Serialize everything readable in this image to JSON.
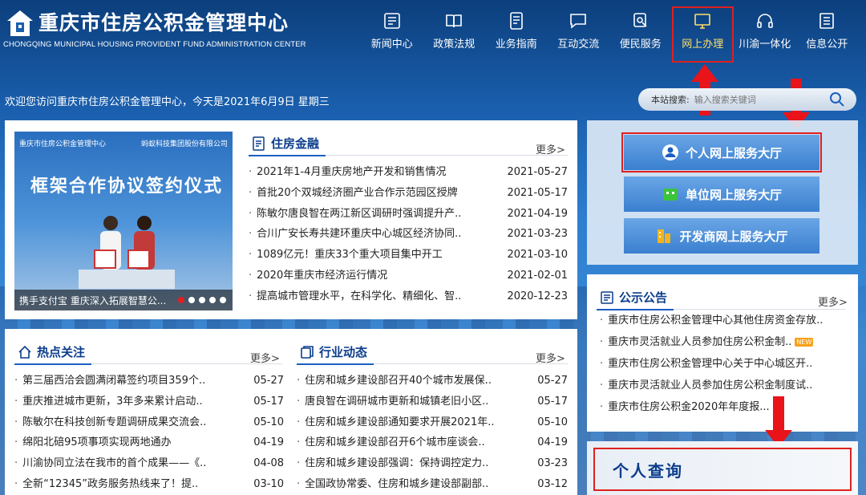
{
  "header": {
    "title": "重庆市住房公积金管理中心",
    "subtitle": "CHONGQING MUNICIPAL HOUSING PROVIDENT FUND ADMINISTRATION CENTER",
    "nav": [
      {
        "label": "新闻中心",
        "icon": "newspaper-icon"
      },
      {
        "label": "政策法规",
        "icon": "book-icon"
      },
      {
        "label": "业务指南",
        "icon": "guide-icon"
      },
      {
        "label": "互动交流",
        "icon": "chat-icon"
      },
      {
        "label": "便民服务",
        "icon": "service-icon"
      },
      {
        "label": "网上办理",
        "icon": "monitor-icon",
        "active": true
      },
      {
        "label": "川渝一体化",
        "icon": "headset-icon"
      },
      {
        "label": "信息公开",
        "icon": "document-icon"
      }
    ]
  },
  "welcome": "欢迎您访问重庆市住房公积金管理中心，今天是2021年6月9日 星期三",
  "search": {
    "label": "本站搜索:",
    "placeholder": "输入搜索关键词"
  },
  "slideshow": {
    "org_left": "重庆市住房公积金管理中心",
    "org_right": "蚂蚁科技集团股份有限公司",
    "headline": "框架合作协议签约仪式",
    "caption": "携手支付宝 重庆深入拓展智慧公..."
  },
  "housing_finance": {
    "title": "住房金融",
    "more": "更多>",
    "items": [
      {
        "title": "2021年1-4月重庆房地产开发和销售情况",
        "date": "2021-05-27"
      },
      {
        "title": "首批20个双城经济圈产业合作示范园区授牌",
        "date": "2021-05-17"
      },
      {
        "title": "陈敏尔唐良智在两江新区调研时强调提升产..",
        "date": "2021-04-19"
      },
      {
        "title": "合川广安长寿共建环重庆中心城区经济协同..",
        "date": "2021-03-23"
      },
      {
        "title": "1089亿元！重庆33个重大项目集中开工",
        "date": "2021-03-10"
      },
      {
        "title": "2020年重庆市经济运行情况",
        "date": "2021-02-01"
      },
      {
        "title": "提高城市管理水平，在科学化、精细化、智..",
        "date": "2020-12-23"
      }
    ]
  },
  "hot_topics": {
    "title": "热点关注",
    "more": "更多>",
    "items": [
      {
        "title": "第三届西洽会圆满闭幕签约项目359个..",
        "date": "05-27"
      },
      {
        "title": "重庆推进城市更新，3年多来累计启动..",
        "date": "05-17"
      },
      {
        "title": "陈敏尔在科技创新专题调研成果交流会..",
        "date": "05-10"
      },
      {
        "title": "绵阳北碚95项事项实现两地通办",
        "date": "04-19"
      },
      {
        "title": "川渝协同立法在我市的首个成果——《..",
        "date": "04-08"
      },
      {
        "title": "全新“12345”政务服务热线来了！提..",
        "date": "03-10"
      }
    ]
  },
  "industry_news": {
    "title": "行业动态",
    "more": "更多>",
    "items": [
      {
        "title": "住房和城乡建设部召开40个城市发展保..",
        "date": "05-27"
      },
      {
        "title": "唐良智在调研城市更新和城镇老旧小区..",
        "date": "05-17"
      },
      {
        "title": "住房和城乡建设部通知要求开展2021年..",
        "date": "05-10"
      },
      {
        "title": "住房和城乡建设部召开6个城市座谈会..",
        "date": "04-19"
      },
      {
        "title": "住房和城乡建设部强调：保持调控定力..",
        "date": "03-23"
      },
      {
        "title": "全国政协常委、住房和城乡建设部副部..",
        "date": "03-12"
      }
    ]
  },
  "services": [
    {
      "label": "个人网上服务大厅",
      "icon": "person-icon",
      "highlighted": true
    },
    {
      "label": "单位网上服务大厅",
      "icon": "building-icon"
    },
    {
      "label": "开发商网上服务大厅",
      "icon": "developer-icon"
    }
  ],
  "notices": {
    "title": "公示公告",
    "more": "更多>",
    "items": [
      {
        "title": "重庆市住房公积金管理中心其他住房资金存放.."
      },
      {
        "title": "重庆市灵活就业人员参加住房公积金制..",
        "badge": "NEW"
      },
      {
        "title": "重庆市住房公积金管理中心关于中心城区开.."
      },
      {
        "title": "重庆市灵活就业人员参加住房公积金制度试.."
      },
      {
        "title": "重庆市住房公积金2020年年度报..."
      }
    ]
  },
  "personal_query": "个人查询",
  "colors": {
    "brand": "#0b3d8c",
    "accent": "#1a5fc0",
    "highlight": "#e02020"
  }
}
